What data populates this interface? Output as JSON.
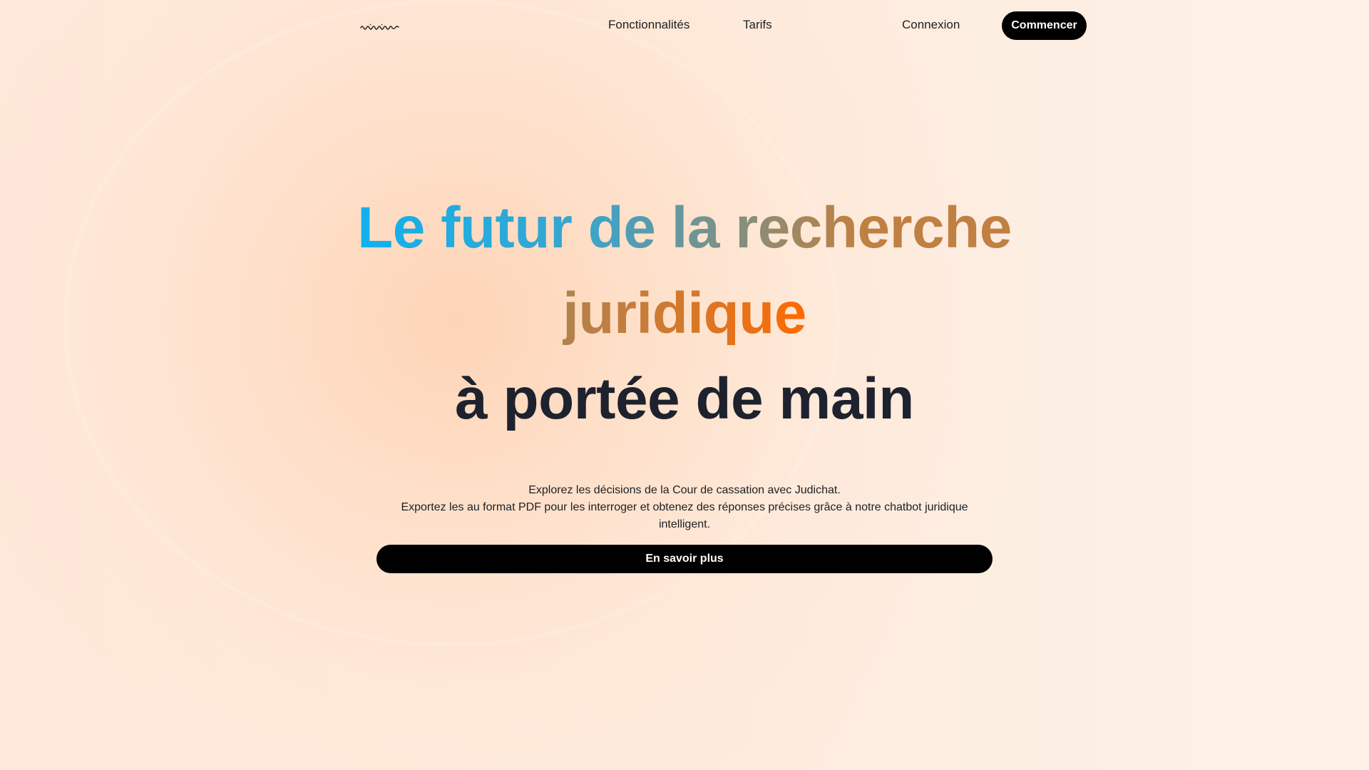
{
  "header": {
    "logo_icon": "signature-logo-icon",
    "nav": [
      {
        "label": "Fonctionnalités"
      },
      {
        "label": "Tarifs"
      }
    ],
    "login_label": "Connexion",
    "start_label": "Commencer"
  },
  "hero": {
    "title_line1": "Le futur de la recherche",
    "title_line2": "juridique",
    "title_line3": "à portée de main",
    "description_line1": "Explorez les décisions de la Cour de cassation avec Judichat.",
    "description_line2": "Exportez les au format PDF pour les interroger et obtenez des réponses précises grâce à notre chatbot juridique intelligent.",
    "cta_label": "En savoir plus"
  },
  "colors": {
    "gradient_start": "#11b0ef",
    "gradient_mid": "#c08042",
    "gradient_end": "#ff6a00",
    "button_bg": "#000000",
    "heading_dark": "#1d222e"
  }
}
